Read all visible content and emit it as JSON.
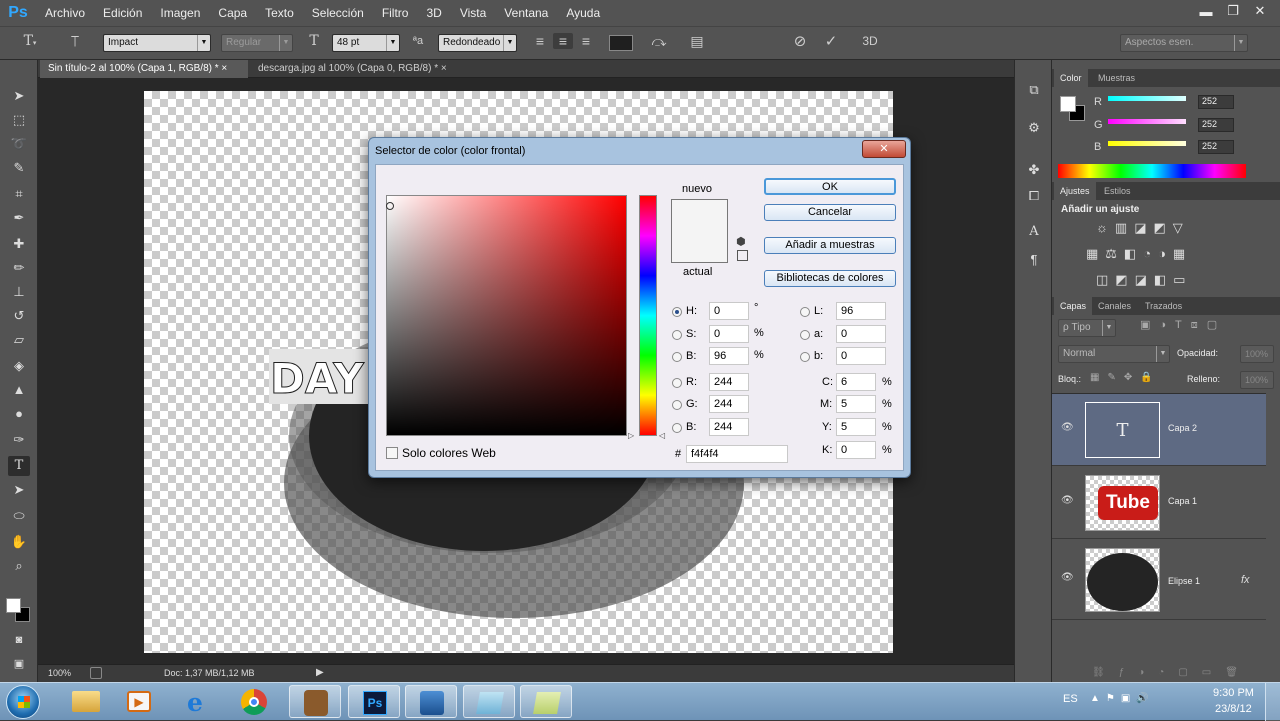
{
  "app": {
    "logo": "Ps"
  },
  "menu": [
    "Archivo",
    "Edición",
    "Imagen",
    "Capa",
    "Texto",
    "Selección",
    "Filtro",
    "3D",
    "Vista",
    "Ventana",
    "Ayuda"
  ],
  "window_controls": {
    "minimize": "▬",
    "restore": "❐",
    "close": "✕"
  },
  "options_bar": {
    "font_family": "Impact",
    "font_style": "Regular",
    "font_size": "48 pt",
    "antialias_label": "ªa",
    "antialias": "Redondeado",
    "workspace": "Aspectos esen.",
    "mode_3d": "3D"
  },
  "doc_tabs": [
    {
      "label": "Sin título-2 al 100% (Capa 1, RGB/8) *",
      "close": "×"
    },
    {
      "label": "descarga.jpg al 100% (Capa 0, RGB/8) *",
      "close": "×"
    }
  ],
  "canvas": {
    "text": "DAY"
  },
  "status": {
    "zoom": "100%",
    "doc": "Doc: 1,37 MB/1,12 MB"
  },
  "color_panel": {
    "tabs": [
      "Color",
      "Muestras"
    ],
    "channels": [
      {
        "label": "R",
        "value": "252",
        "color": "#00d4ff"
      },
      {
        "label": "G",
        "value": "252",
        "color": "#ff3cff"
      },
      {
        "label": "B",
        "value": "252",
        "color": "#ffff00"
      }
    ]
  },
  "adjust_panel": {
    "tabs": [
      "Ajustes",
      "Estilos"
    ],
    "heading": "Añadir un ajuste"
  },
  "layers_panel": {
    "tabs": [
      "Capas",
      "Canales",
      "Trazados"
    ],
    "filter": "ρ Tipo",
    "blend": "Normal",
    "opacity_label": "Opacidad:",
    "opacity": "100%",
    "lock_label": "Bloq.:",
    "fill_label": "Relleno:",
    "fill": "100%",
    "layers": [
      {
        "name": "Capa 2",
        "thumb": "T",
        "selected": true
      },
      {
        "name": "Capa 1",
        "thumb": "Tube",
        "selected": false
      },
      {
        "name": "Elipse 1",
        "thumb": "ellipse",
        "selected": false,
        "fx": "fx"
      }
    ]
  },
  "dialog": {
    "title": "Selector de color (color frontal)",
    "close": "✕",
    "ok": "OK",
    "cancel": "Cancelar",
    "add_swatches": "Añadir a muestras",
    "libraries": "Bibliotecas de colores",
    "new_label": "nuevo",
    "current_label": "actual",
    "web_only": "Solo colores Web",
    "new_color": "#f4f4f4",
    "current_color": "#f4f4f4",
    "hsb": [
      {
        "label": "H:",
        "value": "0",
        "unit": "°",
        "on": true
      },
      {
        "label": "S:",
        "value": "0",
        "unit": "%",
        "on": false
      },
      {
        "label": "B:",
        "value": "96",
        "unit": "%",
        "on": false
      }
    ],
    "rgb": [
      {
        "label": "R:",
        "value": "244"
      },
      {
        "label": "G:",
        "value": "244"
      },
      {
        "label": "B:",
        "value": "244"
      }
    ],
    "lab": [
      {
        "label": "L:",
        "value": "96"
      },
      {
        "label": "a:",
        "value": "0"
      },
      {
        "label": "b:",
        "value": "0"
      }
    ],
    "cmyk": [
      {
        "label": "C:",
        "value": "6",
        "unit": "%"
      },
      {
        "label": "M:",
        "value": "5",
        "unit": "%"
      },
      {
        "label": "Y:",
        "value": "5",
        "unit": "%"
      },
      {
        "label": "K:",
        "value": "0",
        "unit": "%"
      }
    ],
    "hex_label": "#",
    "hex": "f4f4f4"
  },
  "taskbar": {
    "apps": [
      "start-orb",
      "explorer",
      "media-player",
      "internet-explorer",
      "chrome",
      "app-character",
      "photoshop",
      "app-blue",
      "app-notepad",
      "app-green"
    ],
    "lang": "ES",
    "time": "9:30 PM",
    "date": "23/8/12"
  }
}
